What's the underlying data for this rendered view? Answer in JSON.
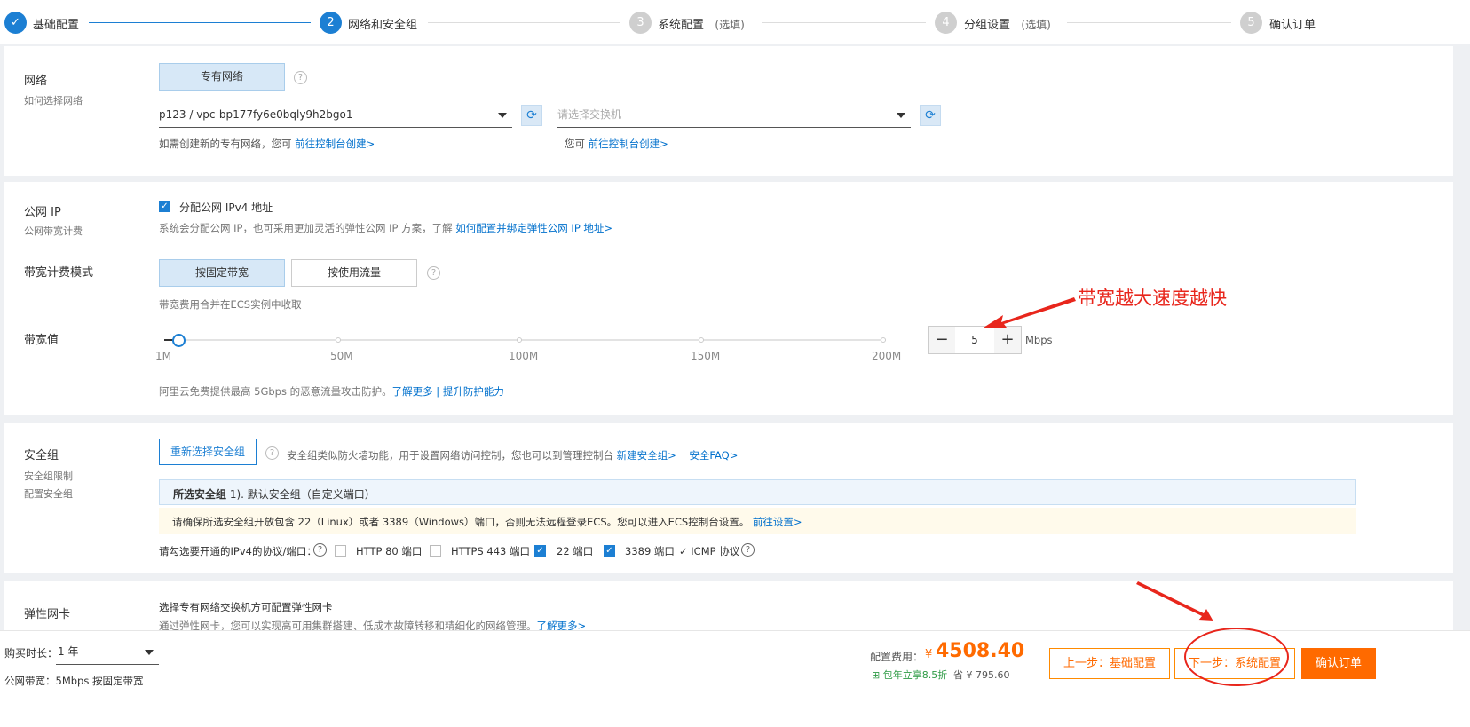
{
  "steps": [
    {
      "num": "✓",
      "label": "基础配置",
      "optional": ""
    },
    {
      "num": "2",
      "label": "网络和安全组",
      "optional": ""
    },
    {
      "num": "3",
      "label": "系统配置",
      "optional": "(选填)"
    },
    {
      "num": "4",
      "label": "分组设置",
      "optional": "(选填)"
    },
    {
      "num": "5",
      "label": "确认订单",
      "optional": ""
    }
  ],
  "network": {
    "title": "网络",
    "subtitle": "如何选择网络",
    "type_button": "专有网络",
    "vpc_value": "p123 / vpc-bp177fy6e0bqly9h2bgo1",
    "vswitch_placeholder": "请选择交换机",
    "vpc_hint": "如需创建新的专有网络，您可",
    "vpc_hint_link": "前往控制台创建>",
    "vswitch_hint": "您可",
    "vswitch_hint_link": "前往控制台创建>"
  },
  "public_ip": {
    "title": "公网 IP",
    "subtitle": "公网带宽计费",
    "checkbox_label": "分配公网 IPv4 地址",
    "checked": true,
    "desc": "系统会分配公网 IP，也可采用更加灵活的弹性公网 IP 方案，了解",
    "desc_link": "如何配置并绑定弹性公网 IP 地址>",
    "billing_title": "带宽计费模式",
    "billing_options": [
      "按固定带宽",
      "按使用流量"
    ],
    "billing_note": "带宽费用合并在ECS实例中收取",
    "bandwidth_title": "带宽值",
    "slider_labels": [
      "1M",
      "50M",
      "100M",
      "150M",
      "200M"
    ],
    "bandwidth_value": "5",
    "bandwidth_min": 1,
    "bandwidth_max": 200,
    "unit": "Mbps",
    "minus": "−",
    "plus": "+",
    "ddos_text": "阿里云免费提供最高 5Gbps 的恶意流量攻击防护。",
    "ddos_link1": "了解更多",
    "ddos_sep": "|",
    "ddos_link2": "提升防护能力",
    "annotation": "带宽越大速度越快"
  },
  "security": {
    "title": "安全组",
    "sub1": "安全组限制",
    "sub2": "配置安全组",
    "reselect_button": "重新选择安全组",
    "desc": "安全组类似防火墙功能，用于设置网络访问控制，您也可以到管理控制台",
    "link_new": "新建安全组>",
    "link_faq": "安全FAQ>",
    "selected_label": "所选安全组",
    "selected_value": "1). 默认安全组（自定义端口）",
    "warning": "请确保所选安全组开放包含 22（Linux）或者 3389（Windows）端口，否则无法远程登录ECS。您可以进入ECS控制台设置。",
    "warning_link": "前往设置>",
    "ports_label": "请勾选要开通的IPv4的协议/端口：",
    "ports": [
      {
        "label": "HTTP 80 端口",
        "checked": false
      },
      {
        "label": "HTTPS 443 端口",
        "checked": false
      },
      {
        "label": "22 端口",
        "checked": true
      },
      {
        "label": "3389 端口",
        "checked": true
      }
    ],
    "icmp": "✓ ICMP 协议"
  },
  "eni": {
    "title": "弹性网卡",
    "line1": "选择专有网络交换机方可配置弹性网卡",
    "line2": "通过弹性网卡，您可以实现高可用集群搭建、低成本故障转移和精细化的网络管理。",
    "line2_link": "了解更多>"
  },
  "footer": {
    "duration_label": "购买时长：",
    "duration_value": "1 年",
    "bandwidth_summary": "公网带宽：5Mbps 按固定带宽",
    "fee_label": "配置费用：",
    "currency": "¥",
    "fee_value": "4508.40",
    "discount_badge": "包年立享8.5折",
    "save_label": "省 ¥ 795.60",
    "prev_button": "上一步：基础配置",
    "next_button": "下一步：系统配置",
    "confirm_button": "确认订单"
  },
  "colors": {
    "accent": "#1c7fd3",
    "orange": "#ff6a00",
    "annotation_red": "#e8261c"
  }
}
